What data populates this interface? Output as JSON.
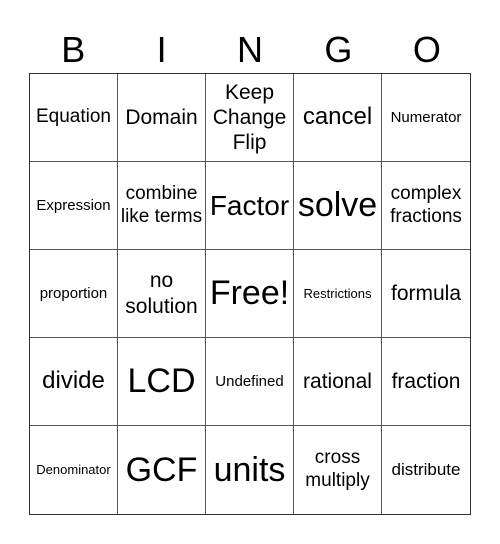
{
  "header": {
    "letters": [
      "B",
      "I",
      "N",
      "G",
      "O"
    ]
  },
  "cells": [
    "Equation",
    "Domain",
    "Keep Change Flip",
    "cancel",
    "Numerator",
    "Expression",
    "combine like terms",
    "Factor",
    "solve",
    "complex fractions",
    "proportion",
    "no solution",
    "Free!",
    "Restrictions",
    "formula",
    "divide",
    "LCD",
    "Undefined",
    "rational",
    "fraction",
    "Denominator",
    "GCF",
    "units",
    "cross multiply",
    "distribute"
  ]
}
